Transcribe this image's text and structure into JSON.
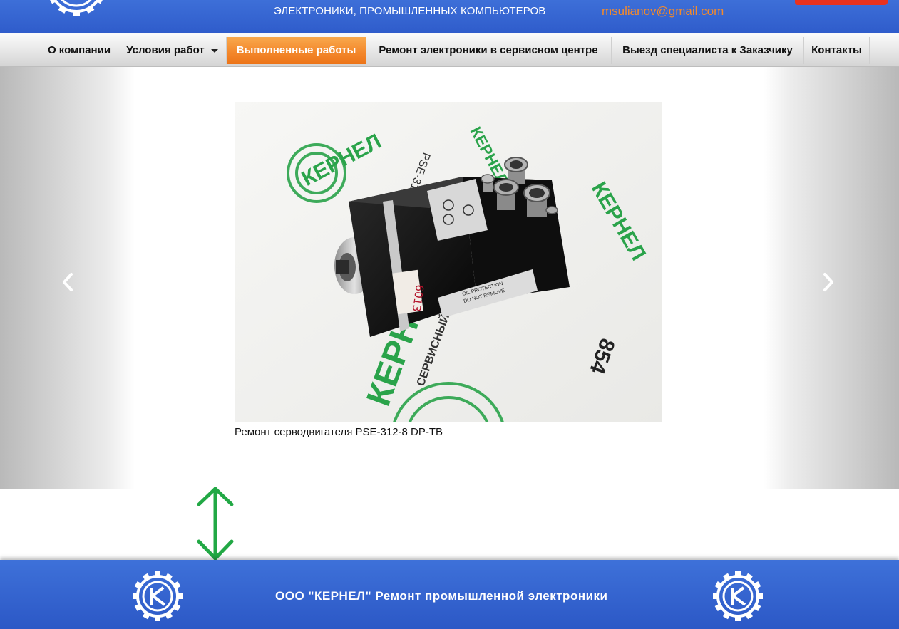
{
  "header": {
    "tagline": "ЭЛЕКТРОНИКИ, ПРОМЫШЛЕННЫХ КОМПЬЮТЕРОВ",
    "email": "msulianov@gmail.com",
    "logo_icon": "gear-logo-icon",
    "colors": {
      "bar": "#3460cf",
      "email": "#f28a2c",
      "button": "#e8321f"
    }
  },
  "nav": {
    "items": [
      {
        "label": "О компании"
      },
      {
        "label": "Условия работ",
        "has_dropdown": true
      },
      {
        "label": "Выполненные работы",
        "active": true
      },
      {
        "label": "Ремонт электроники в сервисном центре"
      },
      {
        "label": "Выезд специалиста к Заказчику"
      },
      {
        "label": "Контакты"
      }
    ],
    "active_color": "#f3862a"
  },
  "slider": {
    "prev_icon": "chevron-left-icon",
    "next_icon": "chevron-right-icon",
    "caption": "Ремонт серводвигателя PSE-312-8 DP-TB",
    "photo": {
      "sticker_number": "6013",
      "label_line1": "OIL PROTECTION",
      "label_line2": "DO NOT REMOVE",
      "bg_logo_text": "КЕРНЕЛ",
      "bg_service_text": "СЕРВИСНЫЙ ЦЕНТР",
      "bg_phone_fragment": "854",
      "bg_phone_fragment2": "PSE-312-8",
      "logo_color": "#2aa34a"
    }
  },
  "annotation": {
    "icon": "double-arrow-vertical-icon",
    "color": "#22a845"
  },
  "footer": {
    "text": "ООО \"КЕРНЕЛ\" Ремонт промышленной электроники",
    "logo_icon": "gear-logo-icon",
    "colors": {
      "bar": "#3564d0"
    }
  }
}
